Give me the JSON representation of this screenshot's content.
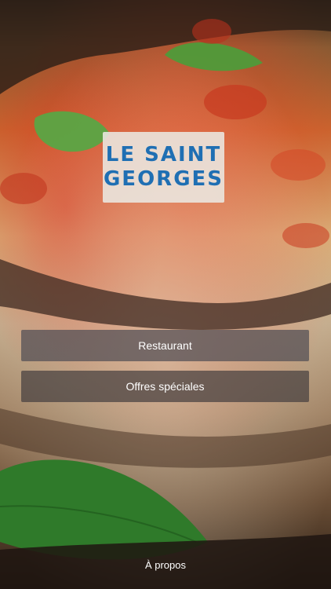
{
  "app": {
    "logo_line1": "LE SAINT",
    "logo_line2": "GEORGES"
  },
  "menu": {
    "items": [
      {
        "label": "Restaurant"
      },
      {
        "label": "Offres spéciales"
      }
    ]
  },
  "footer": {
    "about_label": "À propos"
  },
  "icons": {
    "background": "food-photo-background",
    "basil": "basil-leaf-icon"
  },
  "colors": {
    "logo_text": "#1f6fb3",
    "logo_bg": "#ebe8e1"
  }
}
